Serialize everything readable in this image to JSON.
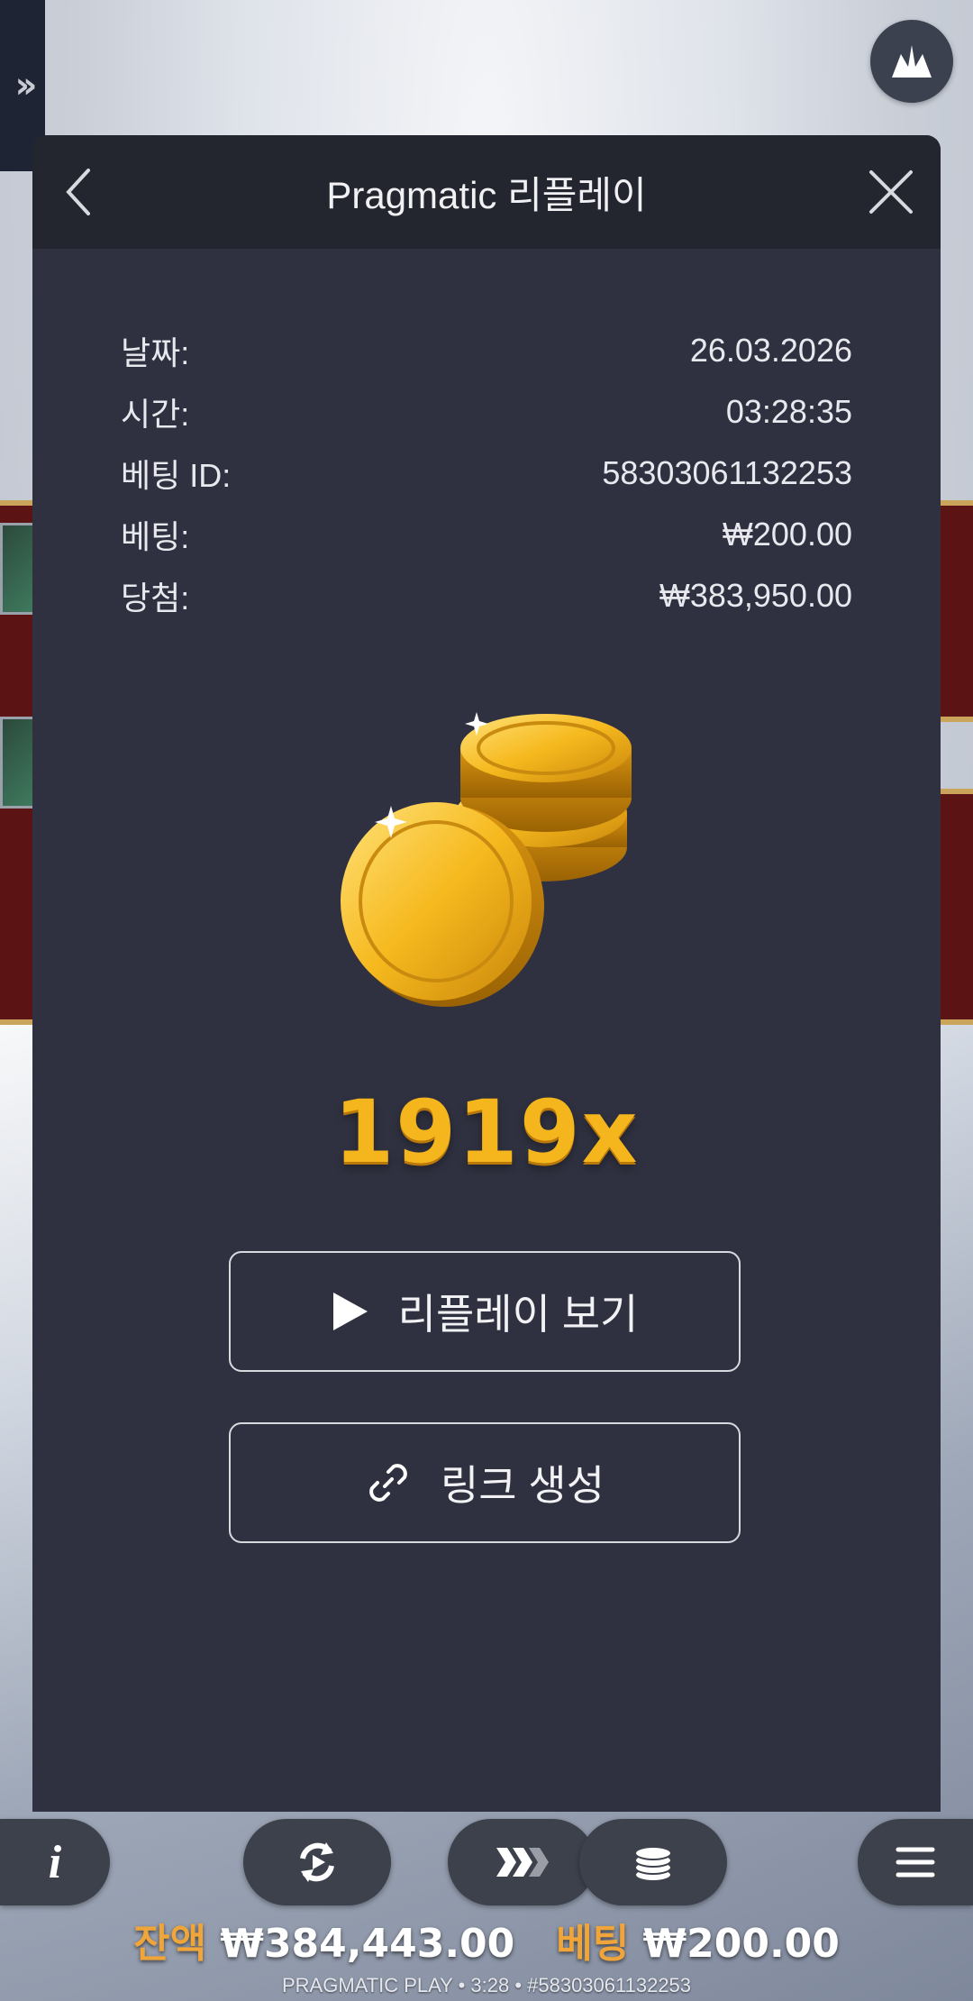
{
  "header": {
    "title": "Pragmatic 리플레이"
  },
  "info": {
    "rows": [
      {
        "label": "날짜:",
        "value": "26.03.2026"
      },
      {
        "label": "시간:",
        "value": "03:28:35"
      },
      {
        "label": "베팅 ID:",
        "value": "58303061132253"
      },
      {
        "label": "베팅:",
        "value": "₩200.00"
      },
      {
        "label": "당첨:",
        "value": "₩383,950.00"
      }
    ]
  },
  "multiplier": "1919x",
  "buttons": {
    "watch_replay": "리플레이 보기",
    "create_link": "링크 생성"
  },
  "status": {
    "balance_label": "잔액",
    "balance_value": "₩384,443.00",
    "bet_label": "베팅",
    "bet_value": "₩200.00"
  },
  "footer": "PRAGMATIC PLAY • 3:28 • #58303061132253",
  "colors": {
    "modal_bg": "#2f3140",
    "header_bg": "#23252f",
    "multiplier": "#f5b51c",
    "status_label": "#f0a53a"
  },
  "icons": [
    "chevron-left-icon",
    "close-icon",
    "play-icon",
    "link-icon",
    "info-icon",
    "autoplay-icon",
    "turbo-icon",
    "coins-icon",
    "menu-icon",
    "crown-logo-icon",
    "double-chevron-icon"
  ]
}
